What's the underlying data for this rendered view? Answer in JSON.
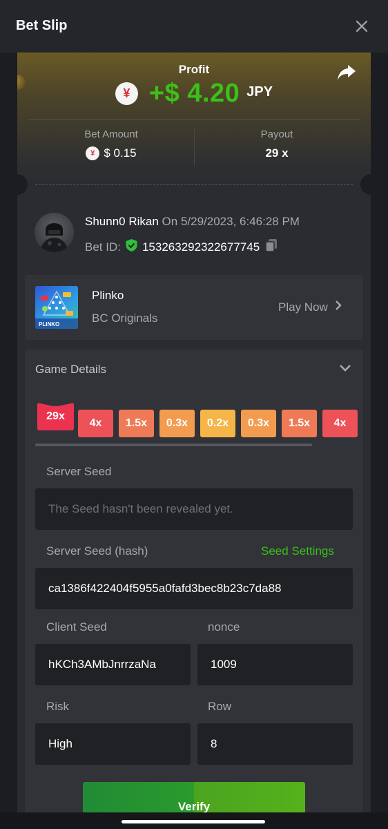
{
  "header": {
    "title": "Bet Slip"
  },
  "profit": {
    "label": "Profit",
    "currency_symbol": "¥",
    "amount": "+$ 4.20",
    "currency": "JPY"
  },
  "stats": {
    "bet_amount_label": "Bet Amount",
    "bet_amount_symbol": "¥",
    "bet_amount_value": "$ 0.15",
    "payout_label": "Payout",
    "payout_value": "29 x"
  },
  "user": {
    "name": "Shunn0 Rikan",
    "date": "On 5/29/2023, 6:46:28 PM",
    "bet_id_label": "Bet ID:",
    "bet_id": "153263292322677745"
  },
  "game": {
    "name": "Plinko",
    "provider": "BC Originals",
    "play_label": "Play Now",
    "thumb_text": "PLINKO"
  },
  "details": {
    "title": "Game Details",
    "multipliers": [
      {
        "label": "29x",
        "color": "#eb3350",
        "active": true
      },
      {
        "label": "4x",
        "color": "#ec5257"
      },
      {
        "label": "1.5x",
        "color": "#ef7a56"
      },
      {
        "label": "0.3x",
        "color": "#f39b4f"
      },
      {
        "label": "0.2x",
        "color": "#f5b548"
      },
      {
        "label": "0.3x",
        "color": "#f39b4f"
      },
      {
        "label": "1.5x",
        "color": "#ef7a56"
      },
      {
        "label": "4x",
        "color": "#ec5257"
      }
    ],
    "server_seed_label": "Server Seed",
    "server_seed_value": "The Seed hasn't been revealed yet.",
    "server_hash_label": "Server Seed (hash)",
    "seed_settings_label": "Seed Settings",
    "server_hash_value": "ca1386f422404f5955a0fafd3bec8b23c7da88",
    "client_seed_label": "Client Seed",
    "client_seed_value": "hKCh3AMbJnrrzaNa",
    "nonce_label": "nonce",
    "nonce_value": "1009",
    "risk_label": "Risk",
    "risk_value": "High",
    "row_label": "Row",
    "row_value": "8",
    "verify_label": "Verify"
  },
  "colors": {
    "accent_green": "#3bc117",
    "background": "#1b1d22",
    "card": "#313338"
  }
}
